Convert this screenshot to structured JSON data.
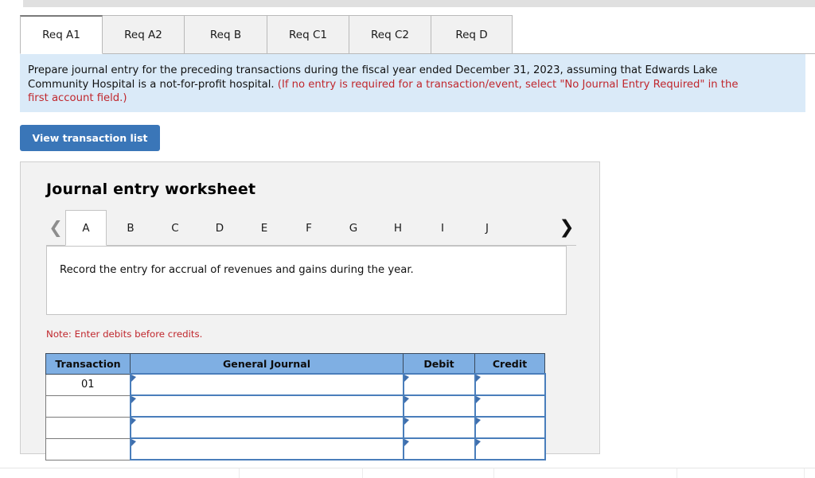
{
  "req_tabs": [
    {
      "label": "Req A1",
      "active": true
    },
    {
      "label": "Req A2",
      "active": false
    },
    {
      "label": "Req B",
      "active": false
    },
    {
      "label": "Req C1",
      "active": false
    },
    {
      "label": "Req C2",
      "active": false
    },
    {
      "label": "Req D",
      "active": false
    }
  ],
  "instruction": {
    "line1_black": "Prepare journal entry for the preceding transactions during the fiscal year ended December 31, 2023, assuming that Edwards Lake",
    "line2_black": "Community Hospital is a not-for-profit hospital. ",
    "line2_red": "(If no entry is required for a transaction/event, select \"No Journal Entry Required\" in the",
    "line3_red": "first account field.)"
  },
  "view_button_label": "View transaction list",
  "worksheet": {
    "title": "Journal entry worksheet",
    "prev_icon": "chevron-left-icon",
    "next_icon": "chevron-right-icon",
    "page_tabs": [
      {
        "label": "A",
        "active": true
      },
      {
        "label": "B",
        "active": false
      },
      {
        "label": "C",
        "active": false
      },
      {
        "label": "D",
        "active": false
      },
      {
        "label": "E",
        "active": false
      },
      {
        "label": "F",
        "active": false
      },
      {
        "label": "G",
        "active": false
      },
      {
        "label": "H",
        "active": false
      },
      {
        "label": "I",
        "active": false
      },
      {
        "label": "J",
        "active": false
      }
    ],
    "prompt": "Record the entry for accrual of revenues and gains during the year.",
    "note": "Note: Enter debits before credits.",
    "table": {
      "headers": [
        "Transaction",
        "General Journal",
        "Debit",
        "Credit"
      ],
      "rows": [
        {
          "transaction": "01",
          "general_journal": "",
          "debit": "",
          "credit": ""
        },
        {
          "transaction": "",
          "general_journal": "",
          "debit": "",
          "credit": ""
        },
        {
          "transaction": "",
          "general_journal": "",
          "debit": "",
          "credit": ""
        },
        {
          "transaction": "",
          "general_journal": "",
          "debit": "",
          "credit": ""
        }
      ]
    }
  },
  "colors": {
    "accent_blue": "#3a76b8",
    "header_blue": "#7fafe3",
    "panel_blue": "#daeaf8",
    "alert_red": "#c0272d",
    "cell_border_blue": "#4a7ebb"
  }
}
